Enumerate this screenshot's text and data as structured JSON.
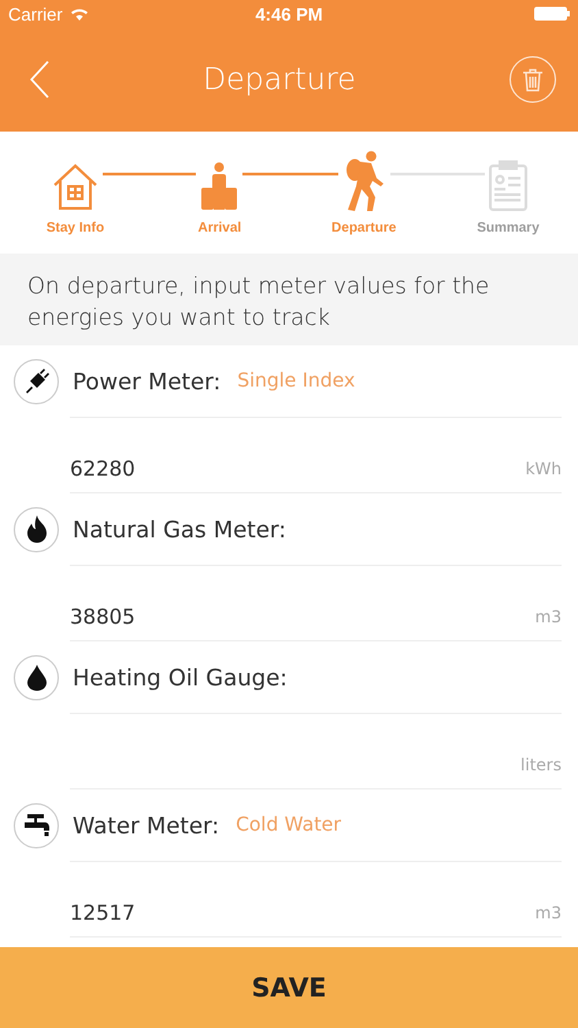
{
  "status_bar": {
    "carrier": "Carrier",
    "time": "4:46 PM"
  },
  "nav": {
    "title": "Departure"
  },
  "steps": [
    {
      "kind": "house",
      "label": "Stay Info",
      "reached": true
    },
    {
      "kind": "arrival",
      "label": "Arrival",
      "reached": true
    },
    {
      "kind": "walker",
      "label": "Departure",
      "reached": true
    },
    {
      "kind": "clipboard",
      "label": "Summary",
      "reached": false
    }
  ],
  "instruction": "On departure, input meter values for the energies you want to track",
  "meters": [
    {
      "kind": "power",
      "label": "Power Meter:",
      "subtype": "Single Index",
      "value": "62280",
      "unit": "kWh"
    },
    {
      "kind": "gas",
      "label": "Natural Gas Meter:",
      "value": "38805",
      "unit": "m3"
    },
    {
      "kind": "oil",
      "label": "Heating Oil Gauge:",
      "unit": "liters"
    },
    {
      "kind": "water",
      "label": "Water Meter:",
      "subtype": "Cold Water",
      "value": "12517",
      "unit": "m3"
    }
  ],
  "save_button": "SAVE"
}
